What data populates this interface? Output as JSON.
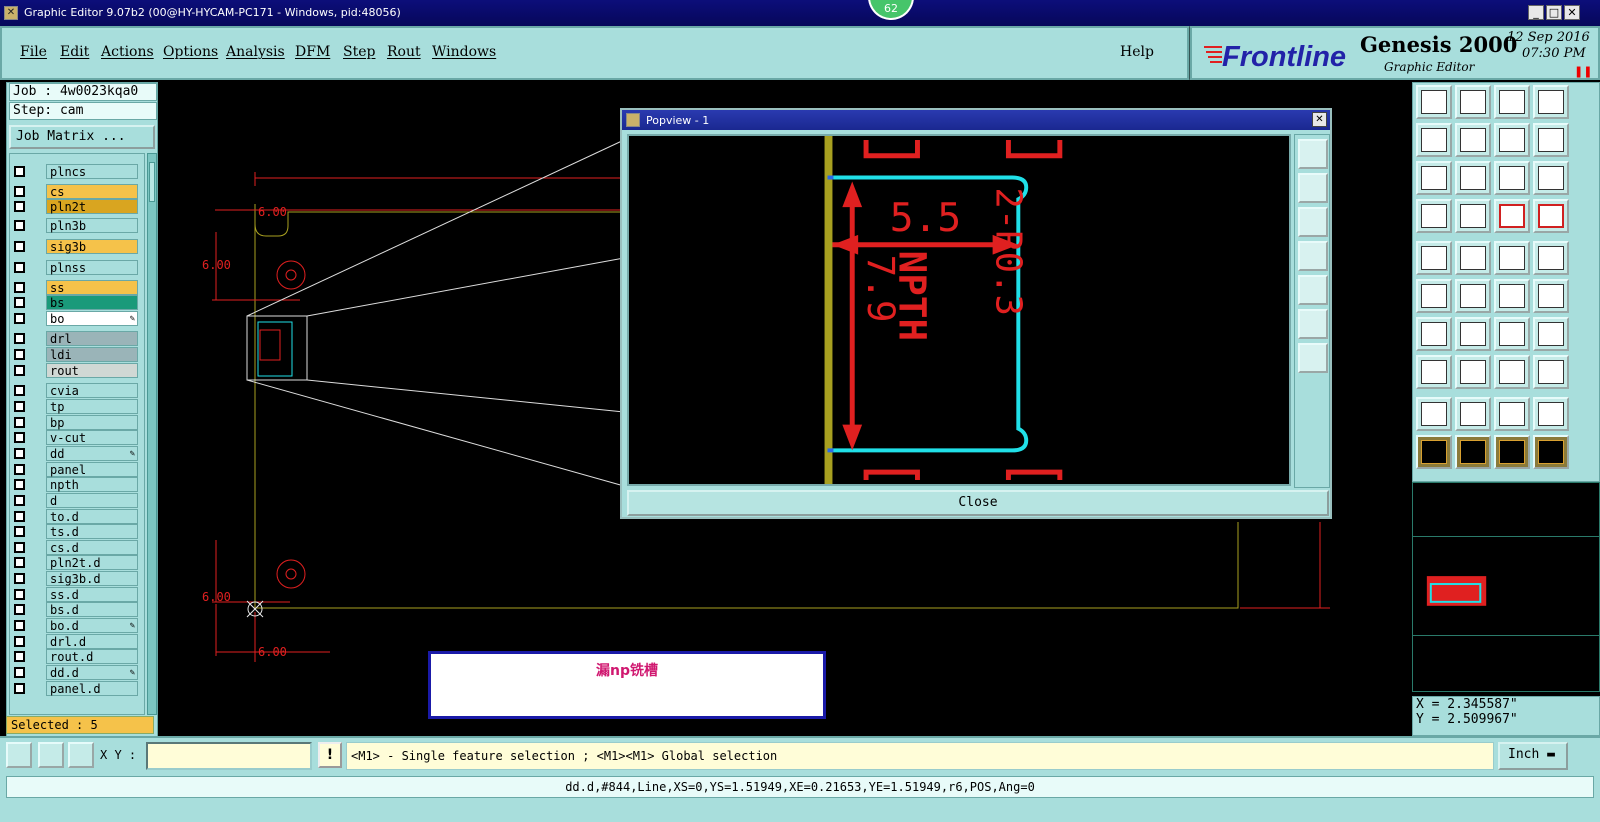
{
  "window": {
    "title": "Graphic Editor 9.07b2 (00@HY-HYCAM-PC171 - Windows, pid:48056)",
    "badge": "62"
  },
  "menu": {
    "items": [
      "File",
      "Edit",
      "Actions",
      "Options",
      "Analysis",
      "DFM",
      "Step",
      "Rout",
      "Windows"
    ],
    "help": "Help"
  },
  "brand": {
    "logo_text": "Frontline",
    "product": "Genesis 2000",
    "subtitle": "Graphic Editor",
    "date": "12 Sep 2016",
    "time": "07:30 PM"
  },
  "job": {
    "job_line": "Job : 4w0023kqa0",
    "step_line": "Step: cam",
    "matrix_button": "Job Matrix ..."
  },
  "layers": [
    {
      "name": "plncs",
      "color": "#a8dedc",
      "lock": false
    },
    {
      "name": "cs",
      "color": "#f5c24a",
      "lock": false
    },
    {
      "name": "pln2t",
      "color": "#d9a520",
      "lock": false
    },
    {
      "name": "pln3b",
      "color": "#a8dedc",
      "lock": false
    },
    {
      "name": "sig3b",
      "color": "#f5c24a",
      "lock": false
    },
    {
      "name": "plnss",
      "color": "#a8dedc",
      "lock": false
    },
    {
      "name": "ss",
      "color": "#f5c24a",
      "lock": false
    },
    {
      "name": "bs",
      "color": "#1a9a7a",
      "lock": false
    },
    {
      "name": "bo",
      "color": "#ffffff",
      "lock": true
    },
    {
      "name": "drl",
      "color": "#9ab4b8",
      "lock": false
    },
    {
      "name": "ldi",
      "color": "#9ab4b8",
      "lock": false
    },
    {
      "name": "rout",
      "color": "#d0d8d4",
      "lock": false
    },
    {
      "name": "cvia",
      "color": "#a8dedc",
      "lock": false
    },
    {
      "name": "tp",
      "color": "#a8dedc",
      "lock": false
    },
    {
      "name": "bp",
      "color": "#a8dedc",
      "lock": false
    },
    {
      "name": "v-cut",
      "color": "#a8dedc",
      "lock": false
    },
    {
      "name": "dd",
      "color": "#a8dedc",
      "lock": true
    },
    {
      "name": "panel",
      "color": "#a8dedc",
      "lock": false
    },
    {
      "name": "npth",
      "color": "#a8dedc",
      "lock": false
    },
    {
      "name": "d",
      "color": "#a8dedc",
      "lock": false
    },
    {
      "name": "to.d",
      "color": "#a8dedc",
      "lock": false
    },
    {
      "name": "ts.d",
      "color": "#a8dedc",
      "lock": false
    },
    {
      "name": "cs.d",
      "color": "#a8dedc",
      "lock": false
    },
    {
      "name": "pln2t.d",
      "color": "#a8dedc",
      "lock": false
    },
    {
      "name": "sig3b.d",
      "color": "#a8dedc",
      "lock": false
    },
    {
      "name": "ss.d",
      "color": "#a8dedc",
      "lock": false
    },
    {
      "name": "bs.d",
      "color": "#a8dedc",
      "lock": false
    },
    {
      "name": "bo.d",
      "color": "#a8dedc",
      "lock": true
    },
    {
      "name": "drl.d",
      "color": "#a8dedc",
      "lock": false
    },
    {
      "name": "rout.d",
      "color": "#a8dedc",
      "lock": false
    },
    {
      "name": "dd.d",
      "color": "#a8dedc",
      "lock": true
    },
    {
      "name": "panel.d",
      "color": "#a8dedc",
      "lock": false
    }
  ],
  "selected": "Selected : 5",
  "canvas": {
    "dim_top": "6.00",
    "dim_left_upper": "6.00",
    "dim_left_lower": "6.00",
    "dim_bottom": "6.00"
  },
  "popview": {
    "title": "Popview - 1",
    "close_label": "Close",
    "dim_width": "5.5",
    "dim_height": "7.9",
    "npth_label": "NPTH",
    "radius_label": "2-R0.3"
  },
  "note": {
    "text": "漏np铣槽"
  },
  "coords": {
    "x": "X = 2.345587\"",
    "y": "Y = 2.509967\""
  },
  "bottombar": {
    "xy_label": "X Y :",
    "xy_value": "",
    "hint": "<M1> - Single feature selection ; <M1><M1> Global selection",
    "units": "Inch"
  },
  "status": {
    "text": "dd.d,#844,Line,XS=0,YS=1.51949,XE=0.21653,YE=1.51949,r6,POS,Ang=0"
  },
  "colors": {
    "panel": "#a8dedc",
    "dim_red": "#e02020",
    "outline_cyan": "#20e0e8",
    "outline_olive": "#a8a020"
  }
}
